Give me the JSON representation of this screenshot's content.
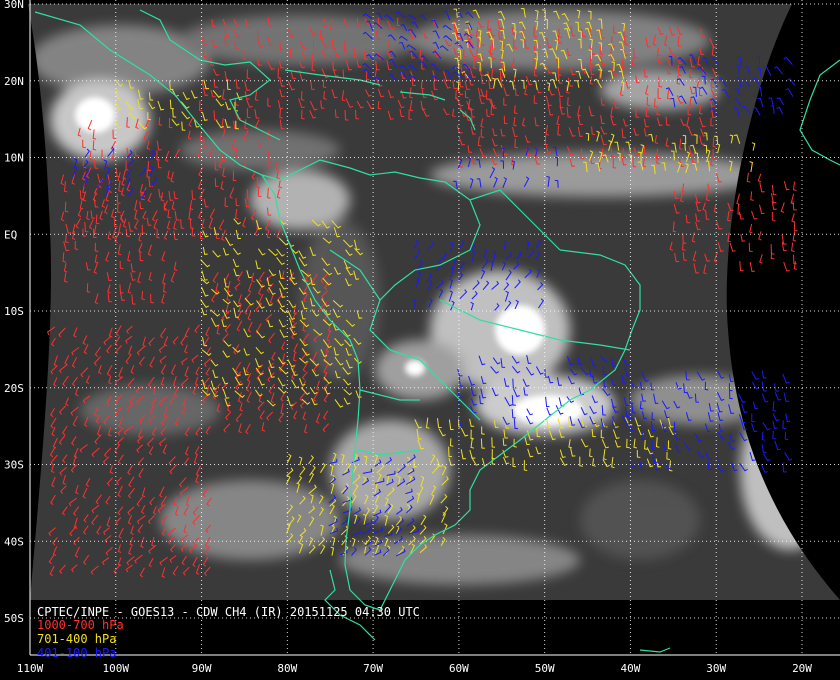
{
  "caption": {
    "title": "CPTEC/INPE - GOES13 - CDW CH4 (IR) 20151125 04:30 UTC"
  },
  "legend": [
    {
      "label": "1000-700 hPa",
      "color": "#ff3030"
    },
    {
      "label": "701-400 hPa",
      "color": "#f0e020"
    },
    {
      "label": "401-100 hPa",
      "color": "#1a1aff"
    }
  ],
  "axes": {
    "lat_labels": [
      "30N",
      "20N",
      "10N",
      "EQ",
      "10S",
      "20S",
      "30S",
      "40S",
      "50S"
    ],
    "lon_labels": [
      "110W",
      "100W",
      "90W",
      "80W",
      "70W",
      "60W",
      "50W",
      "40W",
      "30W",
      "20W"
    ],
    "lat_values": [
      30,
      20,
      10,
      0,
      -10,
      -20,
      -30,
      -40,
      -50
    ],
    "lon_values": [
      -110,
      -100,
      -90,
      -80,
      -70,
      -60,
      -50,
      -40,
      -30,
      -20
    ],
    "lat_range": [
      -55,
      30
    ],
    "lon_range": [
      -110,
      -13
    ]
  },
  "colors": {
    "coastline": "#2fe0a0",
    "grid": "#ffffff",
    "background": "#000000",
    "cloud": "#ffffff"
  },
  "wind_layers": [
    {
      "level": "1000-700 hPa",
      "color": "#ff3030",
      "regions": [
        {
          "lon": [
            -107,
            -88
          ],
          "lat": [
            -44,
            -12
          ],
          "dir": 125
        },
        {
          "lon": [
            -106,
            -92
          ],
          "lat": [
            -8,
            8
          ],
          "dir": 95
        },
        {
          "lon": [
            -90,
            -55
          ],
          "lat": [
            15,
            28
          ],
          "dir": 80
        },
        {
          "lon": [
            -60,
            -30
          ],
          "lat": [
            10,
            27
          ],
          "dir": 85
        },
        {
          "lon": [
            -35,
            -20
          ],
          "lat": [
            -5,
            8
          ],
          "dir": 90
        },
        {
          "lon": [
            -88,
            -75
          ],
          "lat": [
            -25,
            -5
          ],
          "dir": 120
        },
        {
          "lon": [
            -104,
            -80
          ],
          "lat": [
            0,
            15
          ],
          "dir": 100
        }
      ]
    },
    {
      "level": "701-400 hPa",
      "color": "#f0e020",
      "regions": [
        {
          "lon": [
            -90,
            -72
          ],
          "lat": [
            -22,
            2
          ],
          "dir": 60
        },
        {
          "lon": [
            -80,
            -62
          ],
          "lat": [
            -42,
            -30
          ],
          "dir": 300
        },
        {
          "lon": [
            -65,
            -35
          ],
          "lat": [
            -30,
            -24
          ],
          "dir": 80
        },
        {
          "lon": [
            -60,
            -40
          ],
          "lat": [
            18,
            28
          ],
          "dir": 260
        },
        {
          "lon": [
            -45,
            -25
          ],
          "lat": [
            8,
            12
          ],
          "dir": 270
        },
        {
          "lon": [
            -100,
            -85
          ],
          "lat": [
            14,
            20
          ],
          "dir": 70
        }
      ]
    },
    {
      "level": "401-100 hPa",
      "color": "#1a1aff",
      "regions": [
        {
          "lon": [
            -65,
            -50
          ],
          "lat": [
            -10,
            -2
          ],
          "dir": 300
        },
        {
          "lon": [
            -60,
            -40
          ],
          "lat": [
            -24,
            -16
          ],
          "dir": 70
        },
        {
          "lon": [
            -40,
            -22
          ],
          "lat": [
            -30,
            -18
          ],
          "dir": 75
        },
        {
          "lon": [
            -75,
            -65
          ],
          "lat": [
            -42,
            -30
          ],
          "dir": 330
        },
        {
          "lon": [
            -35,
            -20
          ],
          "lat": [
            15,
            22
          ],
          "dir": 250
        },
        {
          "lon": [
            -60,
            -48
          ],
          "lat": [
            5,
            10
          ],
          "dir": 280
        },
        {
          "lon": [
            -70,
            -58
          ],
          "lat": [
            20,
            28
          ],
          "dir": 230
        },
        {
          "lon": [
            -105,
            -95
          ],
          "lat": [
            4,
            10
          ],
          "dir": 300
        }
      ]
    }
  ]
}
